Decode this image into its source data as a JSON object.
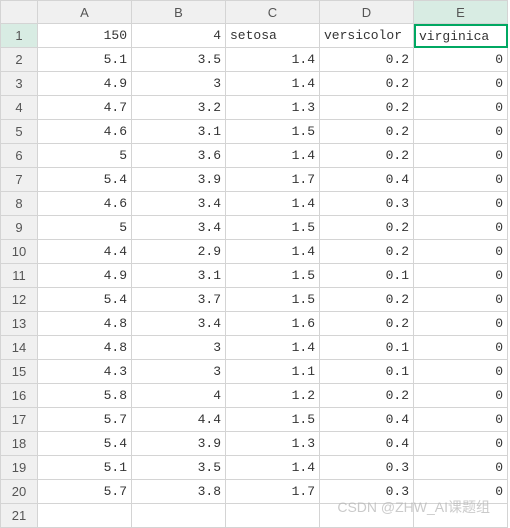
{
  "columns": [
    "",
    "A",
    "B",
    "C",
    "D",
    "E"
  ],
  "active_cell": {
    "row": 1,
    "col": 5
  },
  "chart_data": {
    "type": "table",
    "headers_row": {
      "A": 150,
      "B": 4,
      "C": "setosa",
      "D": "versicolor",
      "E": "virginica"
    },
    "rows": [
      {
        "rn": 1,
        "A": "150",
        "B": "4",
        "C": "setosa",
        "D": "versicolor",
        "E": "virginica",
        "types": {
          "A": "num",
          "B": "num",
          "C": "text",
          "D": "text",
          "E": "text"
        }
      },
      {
        "rn": 2,
        "A": "5.1",
        "B": "3.5",
        "C": "1.4",
        "D": "0.2",
        "E": "0",
        "types": {
          "A": "num",
          "B": "num",
          "C": "num",
          "D": "num",
          "E": "num"
        }
      },
      {
        "rn": 3,
        "A": "4.9",
        "B": "3",
        "C": "1.4",
        "D": "0.2",
        "E": "0",
        "types": {
          "A": "num",
          "B": "num",
          "C": "num",
          "D": "num",
          "E": "num"
        }
      },
      {
        "rn": 4,
        "A": "4.7",
        "B": "3.2",
        "C": "1.3",
        "D": "0.2",
        "E": "0",
        "types": {
          "A": "num",
          "B": "num",
          "C": "num",
          "D": "num",
          "E": "num"
        }
      },
      {
        "rn": 5,
        "A": "4.6",
        "B": "3.1",
        "C": "1.5",
        "D": "0.2",
        "E": "0",
        "types": {
          "A": "num",
          "B": "num",
          "C": "num",
          "D": "num",
          "E": "num"
        }
      },
      {
        "rn": 6,
        "A": "5",
        "B": "3.6",
        "C": "1.4",
        "D": "0.2",
        "E": "0",
        "types": {
          "A": "num",
          "B": "num",
          "C": "num",
          "D": "num",
          "E": "num"
        }
      },
      {
        "rn": 7,
        "A": "5.4",
        "B": "3.9",
        "C": "1.7",
        "D": "0.4",
        "E": "0",
        "types": {
          "A": "num",
          "B": "num",
          "C": "num",
          "D": "num",
          "E": "num"
        }
      },
      {
        "rn": 8,
        "A": "4.6",
        "B": "3.4",
        "C": "1.4",
        "D": "0.3",
        "E": "0",
        "types": {
          "A": "num",
          "B": "num",
          "C": "num",
          "D": "num",
          "E": "num"
        }
      },
      {
        "rn": 9,
        "A": "5",
        "B": "3.4",
        "C": "1.5",
        "D": "0.2",
        "E": "0",
        "types": {
          "A": "num",
          "B": "num",
          "C": "num",
          "D": "num",
          "E": "num"
        }
      },
      {
        "rn": 10,
        "A": "4.4",
        "B": "2.9",
        "C": "1.4",
        "D": "0.2",
        "E": "0",
        "types": {
          "A": "num",
          "B": "num",
          "C": "num",
          "D": "num",
          "E": "num"
        }
      },
      {
        "rn": 11,
        "A": "4.9",
        "B": "3.1",
        "C": "1.5",
        "D": "0.1",
        "E": "0",
        "types": {
          "A": "num",
          "B": "num",
          "C": "num",
          "D": "num",
          "E": "num"
        }
      },
      {
        "rn": 12,
        "A": "5.4",
        "B": "3.7",
        "C": "1.5",
        "D": "0.2",
        "E": "0",
        "types": {
          "A": "num",
          "B": "num",
          "C": "num",
          "D": "num",
          "E": "num"
        }
      },
      {
        "rn": 13,
        "A": "4.8",
        "B": "3.4",
        "C": "1.6",
        "D": "0.2",
        "E": "0",
        "types": {
          "A": "num",
          "B": "num",
          "C": "num",
          "D": "num",
          "E": "num"
        }
      },
      {
        "rn": 14,
        "A": "4.8",
        "B": "3",
        "C": "1.4",
        "D": "0.1",
        "E": "0",
        "types": {
          "A": "num",
          "B": "num",
          "C": "num",
          "D": "num",
          "E": "num"
        }
      },
      {
        "rn": 15,
        "A": "4.3",
        "B": "3",
        "C": "1.1",
        "D": "0.1",
        "E": "0",
        "types": {
          "A": "num",
          "B": "num",
          "C": "num",
          "D": "num",
          "E": "num"
        }
      },
      {
        "rn": 16,
        "A": "5.8",
        "B": "4",
        "C": "1.2",
        "D": "0.2",
        "E": "0",
        "types": {
          "A": "num",
          "B": "num",
          "C": "num",
          "D": "num",
          "E": "num"
        }
      },
      {
        "rn": 17,
        "A": "5.7",
        "B": "4.4",
        "C": "1.5",
        "D": "0.4",
        "E": "0",
        "types": {
          "A": "num",
          "B": "num",
          "C": "num",
          "D": "num",
          "E": "num"
        }
      },
      {
        "rn": 18,
        "A": "5.4",
        "B": "3.9",
        "C": "1.3",
        "D": "0.4",
        "E": "0",
        "types": {
          "A": "num",
          "B": "num",
          "C": "num",
          "D": "num",
          "E": "num"
        }
      },
      {
        "rn": 19,
        "A": "5.1",
        "B": "3.5",
        "C": "1.4",
        "D": "0.3",
        "E": "0",
        "types": {
          "A": "num",
          "B": "num",
          "C": "num",
          "D": "num",
          "E": "num"
        }
      },
      {
        "rn": 20,
        "A": "5.7",
        "B": "3.8",
        "C": "1.7",
        "D": "0.3",
        "E": "0",
        "types": {
          "A": "num",
          "B": "num",
          "C": "num",
          "D": "num",
          "E": "num"
        }
      },
      {
        "rn": 21,
        "A": "",
        "B": "",
        "C": "",
        "D": "",
        "E": "",
        "types": {
          "A": "num",
          "B": "num",
          "C": "num",
          "D": "num",
          "E": "num"
        }
      }
    ]
  },
  "watermark": "CSDN @ZHW_AI课题组"
}
